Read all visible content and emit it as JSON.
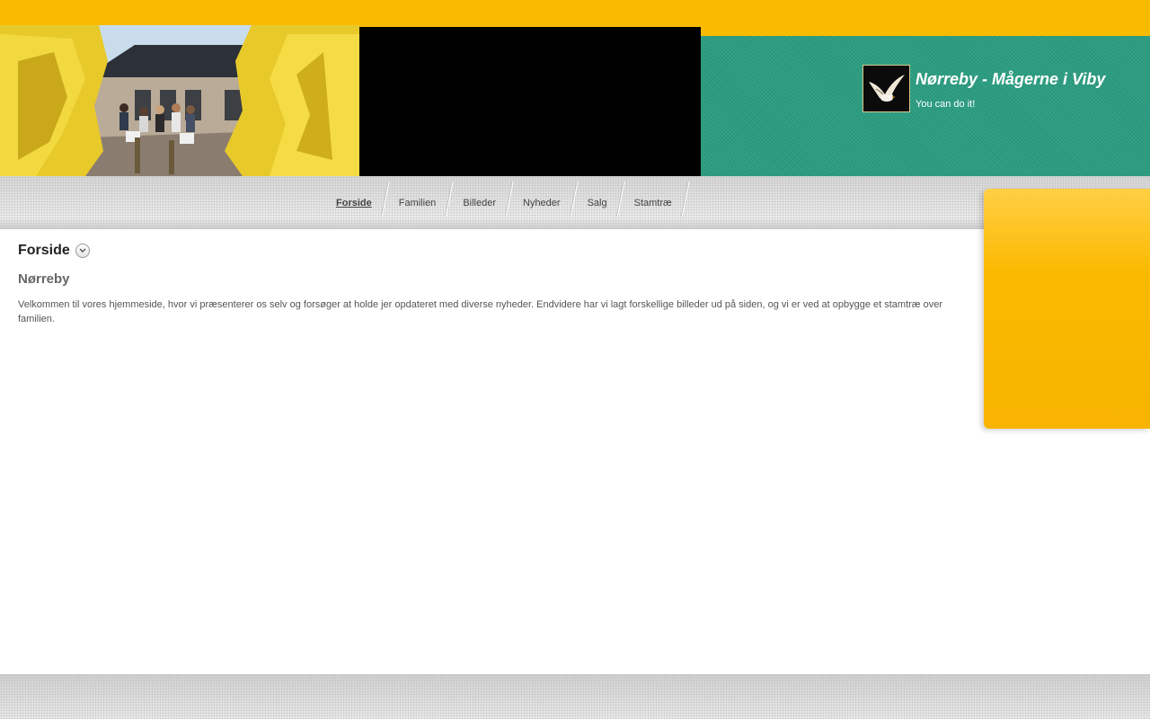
{
  "header": {
    "site_title": "Nørreby - Mågerne i Viby",
    "slogan": "You can do it!",
    "logo_icon": "seagull-icon",
    "hero_icon": "house-garden-photo-icon"
  },
  "nav": {
    "items": [
      {
        "label": "Forside",
        "active": true
      },
      {
        "label": "Familien",
        "active": false
      },
      {
        "label": "Billeder",
        "active": false
      },
      {
        "label": "Nyheder",
        "active": false
      },
      {
        "label": "Salg",
        "active": false
      },
      {
        "label": "Stamtræ",
        "active": false
      }
    ]
  },
  "content": {
    "page_title": "Forside",
    "subheading": "Nørreby",
    "body": "Velkommen til vores hjemmeside, hvor vi præsenterer os selv og forsøger at holde jer opdateret med diverse nyheder. Endvidere har vi lagt forskellige billeder ud på siden, og vi er ved at opbygge et stamtræ over familien.",
    "dropdown_icon": "chevron-down-icon"
  },
  "colors": {
    "accent": "#f8bb00",
    "teal": "#2a9c80",
    "black": "#000000"
  }
}
